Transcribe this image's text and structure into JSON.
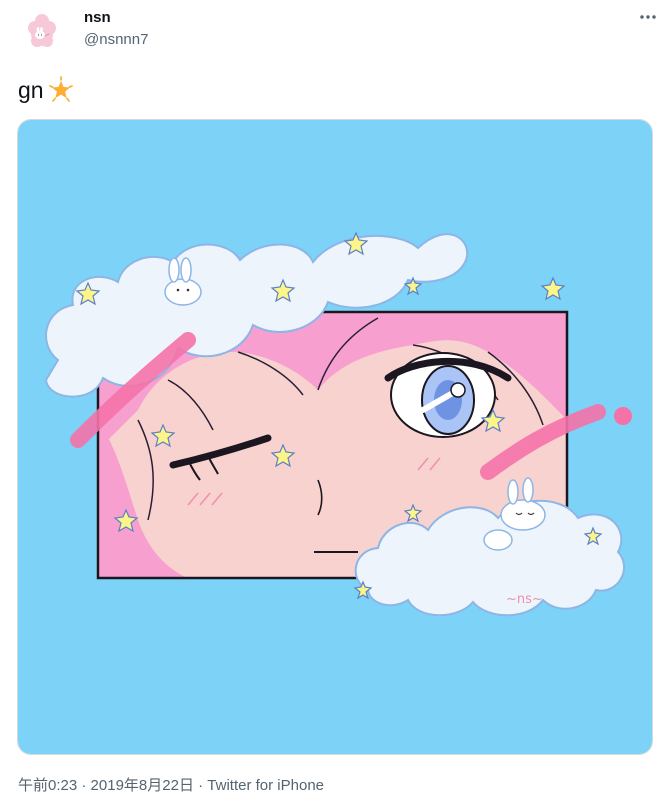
{
  "author": {
    "display_name": "nsn",
    "username": "@nsnnn7",
    "avatar_icon": "pink-cloud-bunny-avatar"
  },
  "header": {
    "more_icon": "more-horizontal-icon"
  },
  "tweet": {
    "text": "gn",
    "emoji": "glowing-star-emoji"
  },
  "media": {
    "background_color": "#7cd3f7",
    "accent_pink": "#f472a8",
    "hair_pink": "#f7a0cf",
    "skin_color": "#f8d2cf",
    "cloud_color": "#eef4fc",
    "signature": "~ns~"
  },
  "meta": {
    "time": "午前0:23",
    "separator_1": " · ",
    "date": "2019年8月22日",
    "separator_2": " · ",
    "source": "Twitter for iPhone"
  }
}
